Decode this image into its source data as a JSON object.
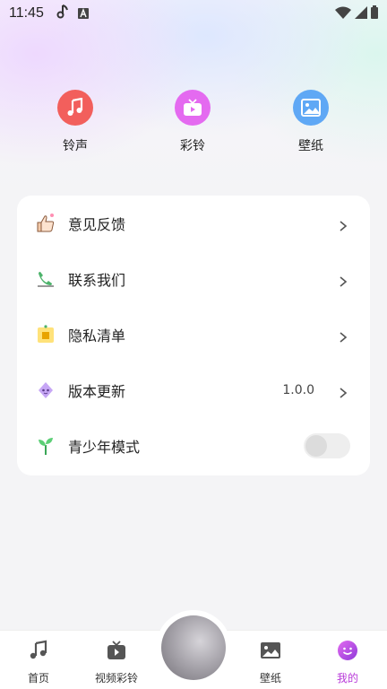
{
  "status_bar": {
    "time": "11:45"
  },
  "shortcuts": [
    {
      "label": "铃声",
      "icon": "music-note-icon",
      "color": "#f25f5c"
    },
    {
      "label": "彩铃",
      "icon": "tv-play-icon",
      "color": "#e46af0"
    },
    {
      "label": "壁纸",
      "icon": "picture-icon",
      "color": "#5fa8f5"
    }
  ],
  "menu": {
    "items": [
      {
        "label": "意见反馈",
        "icon": "feedback-thumb-icon"
      },
      {
        "label": "联系我们",
        "icon": "phone-icon"
      },
      {
        "label": "隐私清单",
        "icon": "privacy-list-icon"
      },
      {
        "label": "版本更新",
        "icon": "version-update-icon",
        "value": "1.0.0"
      },
      {
        "label": "青少年模式",
        "icon": "sprout-icon",
        "toggle": false
      }
    ]
  },
  "bottom_nav": {
    "items": [
      {
        "label": "首页",
        "icon": "music-note-icon"
      },
      {
        "label": "视频彩铃",
        "icon": "tv-play-icon"
      },
      {
        "label": "壁纸",
        "icon": "picture-icon"
      },
      {
        "label": "我的",
        "icon": "smile-icon",
        "active": true
      }
    ],
    "accent_color": "#b83ad9"
  }
}
